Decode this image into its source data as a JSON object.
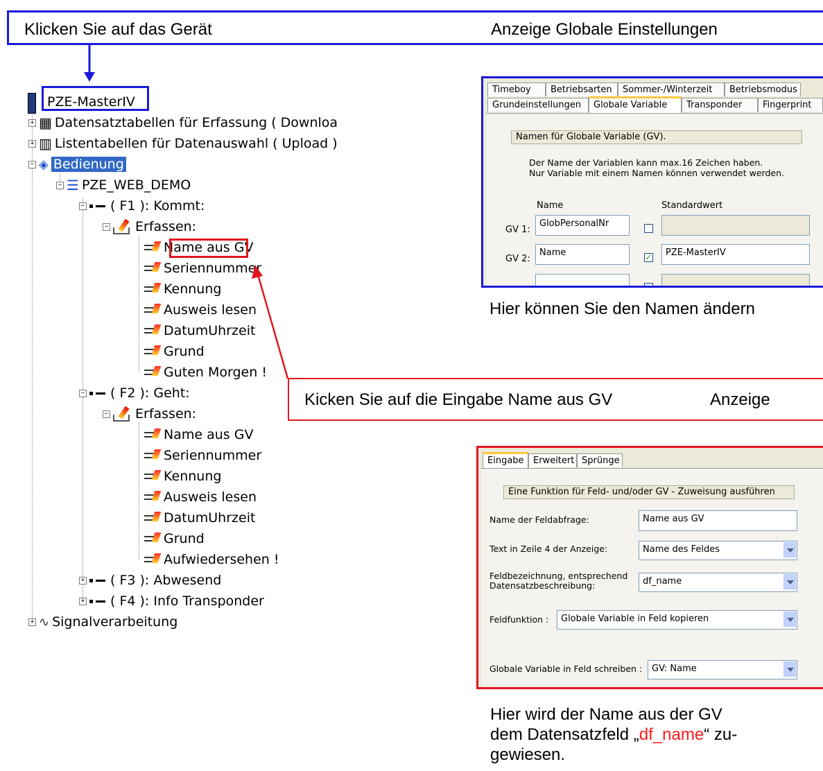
{
  "callout_top": {
    "left_text": "Klicken Sie auf das Gerät",
    "right_text": "Anzeige Globale Einstellungen"
  },
  "tree": {
    "root": "PZE-MasterIV",
    "items": [
      {
        "label": "Datensatztabellen für Erfassung ( Downloa"
      },
      {
        "label": "Listentabellen für Datenauswahl ( Upload )"
      },
      {
        "label": "Bedienung"
      },
      {
        "label": "PZE_WEB_DEMO"
      },
      {
        "label": "( F1 ): Kommt:"
      },
      {
        "label": "Erfassen:"
      }
    ],
    "f1_entries": [
      "Name aus GV",
      "Seriennummer",
      "Kennung",
      "Ausweis lesen",
      "DatumUhrzeit",
      "Grund",
      "Guten Morgen !"
    ],
    "f2_label": "( F2 ): Geht:",
    "f2_erfassen": "Erfassen:",
    "f2_entries": [
      "Name aus GV",
      "Seriennummer",
      "Kennung",
      "Ausweis lesen",
      "DatumUhrzeit",
      "Grund",
      "Aufwiedersehen !"
    ],
    "f3_label": "( F3 ): Abwesend",
    "f4_label": "( F4 ): Info Transponder",
    "signal": "Signalverarbeitung"
  },
  "callout_middle": {
    "text": "Kicken Sie auf die Eingabe Name aus GV",
    "suffix": "Anzeige"
  },
  "global_panel": {
    "tabs_back": [
      "Timeboy",
      "Betriebsarten",
      "Sommer-/Winterzeit",
      "Betriebsmodus"
    ],
    "tabs_front": [
      "Grundeinstellungen",
      "Globale Variable",
      "Transponder",
      "Fingerprint"
    ],
    "group_title": "Namen für Globale Variable (GV).",
    "info_line1": "Der Name der Variablen kann max.16  Zeichen haben.",
    "info_line2": "Nur Variable mit einem Namen können verwendet werden.",
    "col_name": "Name",
    "col_default": "Standardwert",
    "rows": [
      {
        "label": "GV 1:",
        "name": "GlobPersonalNr",
        "checked": "",
        "default": ""
      },
      {
        "label": "GV 2:",
        "name": "Name",
        "checked": "✓",
        "default": "PZE-MasterIV"
      }
    ],
    "caption": "Hier können Sie den Namen ändern"
  },
  "input_panel": {
    "tabs": [
      "Eingabe",
      "Erweitert",
      "Sprünge"
    ],
    "group_title": "Eine Funktion für Feld- und/oder GV - Zuweisung ausführen",
    "name_label": "Name der Feldabfrage:",
    "name_value": "Name aus GV",
    "text_label": "Text in Zeile 4 der Anzeige:",
    "text_value": "Name des Feldes",
    "feld_label_1": "Feldbezeichnung, entsprechend",
    "feld_label_2": "Datensatzbeschreibung:",
    "feld_value": "df_name",
    "func_label": "Feldfunktion :",
    "func_value": "Globale Variable in Feld kopieren",
    "gv_label": "Globale Variable in Feld schreiben :",
    "gv_value": "GV: Name"
  },
  "bottom_caption": {
    "line1": "Hier wird der Name aus der GV",
    "line2_pre": "dem Datensatzfeld „",
    "line2_highlight": "df_name",
    "line2_post": "“ zu-",
    "line3": "gewiesen."
  },
  "colors": {
    "blue_frame": "#1a1adb",
    "red_frame": "#e0161f",
    "highlight_text": "#ff1a1a",
    "selection": "#3169c6"
  }
}
